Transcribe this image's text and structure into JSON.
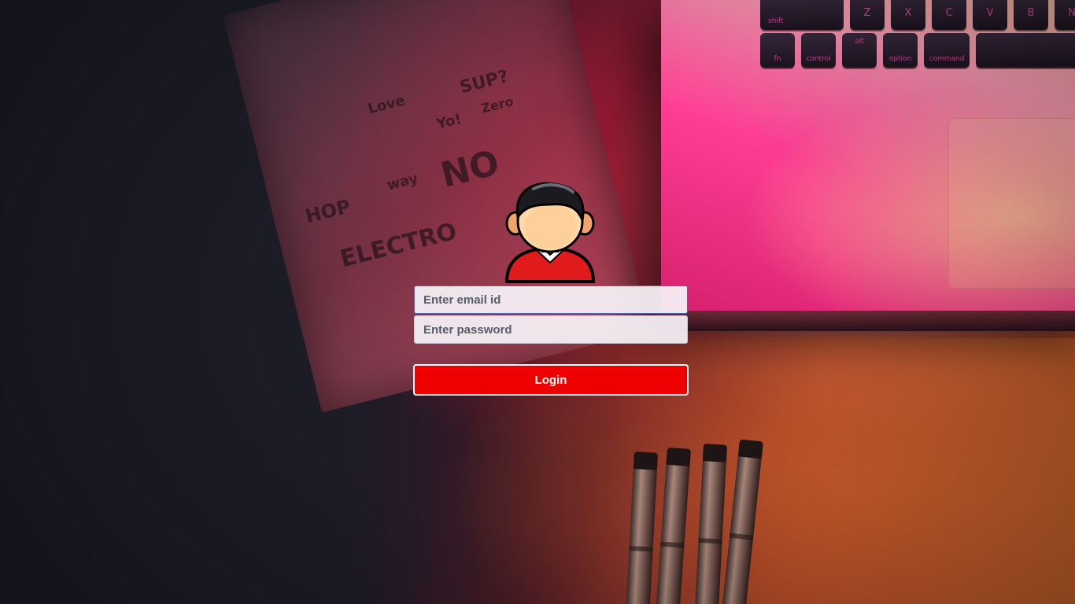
{
  "login": {
    "email_placeholder": "Enter email id",
    "password_placeholder": "Enter password",
    "button_label": "Login"
  },
  "background": {
    "notebook_doodles": [
      "SUP?",
      "Zero",
      "NO",
      "HOP",
      "way",
      "ELECTRO",
      "Love",
      "Yo!"
    ],
    "keyboard_keys_row1": [
      "shift",
      "Z",
      "X",
      "C",
      "V",
      "B",
      "N"
    ],
    "keyboard_keys_row2": [
      "fn",
      "control",
      "alt",
      "option",
      "command"
    ]
  },
  "colors": {
    "button": "#ee0000",
    "input_focus_border": "#4a67b8",
    "avatar_shirt": "#e11b1b"
  },
  "icons": {
    "avatar": "user-avatar-icon"
  }
}
